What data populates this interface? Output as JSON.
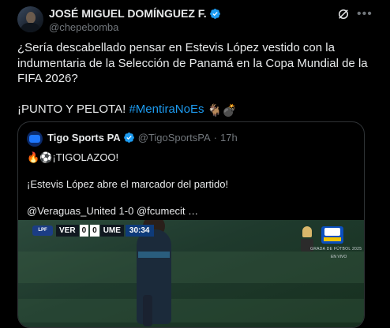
{
  "author": {
    "name": "JOSÉ MIGUEL DOMÍNGUEZ F.",
    "handle": "@chepebomba"
  },
  "post": {
    "line1": "¿Sería descabellado pensar en Estevis López vestido con la indumentaria de la Selección de Panamá en la Copa Mundial de la FIFA 2026?",
    "line2_prefix": "¡PUNTO Y PELOTA! ",
    "hashtag": "#MentiraNoEs",
    "line2_emojis": "🐐💣"
  },
  "quote": {
    "name": "Tigo Sports PA",
    "handle": "@TigoSportsPA",
    "separator": "·",
    "time": "17h",
    "line1": "🔥⚽¡TIGOLAZOO!",
    "line2": "¡Estevis López abre el marcador del partido!",
    "line3": "@Veraguas_United 1-0 @fcumecit …"
  },
  "video": {
    "league_badge": "LPF",
    "home_team": "VER",
    "home_score": "0",
    "away_score": "0",
    "away_team": "UME",
    "clock": "30:34",
    "ticker": "GRADA DE FÚTBOL 2025",
    "live_label": "EN VIVO"
  },
  "colors": {
    "accent": "#1d9bf0",
    "background": "#000000",
    "text": "#e7e9ea",
    "muted": "#71767b",
    "border": "#2f3336"
  },
  "icons": {
    "verified": "verified-badge-icon",
    "grok": "grok-icon",
    "more": "more-options-icon"
  }
}
